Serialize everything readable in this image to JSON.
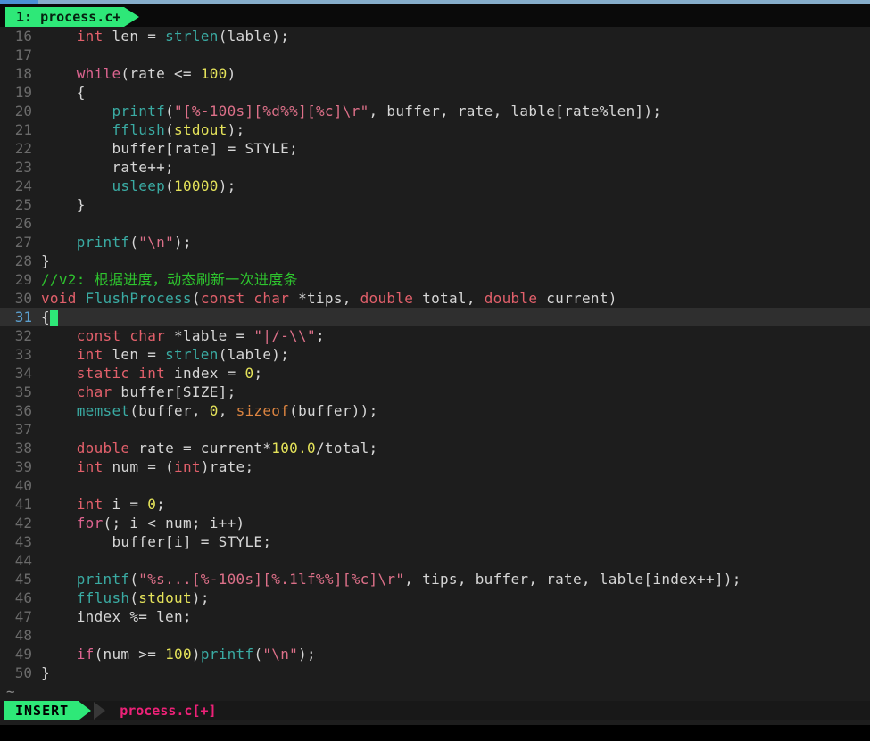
{
  "window": {
    "tab": {
      "label": "1: process.c+"
    },
    "status": {
      "mode": "INSERT",
      "file": "process.c[+]"
    },
    "empty_line_marker": "~"
  },
  "colors": {
    "ui": {
      "background": "#1d1d1d",
      "chrome_black": "#0a0a0a",
      "green": "#2ee878",
      "status_pink": "#ee2178",
      "topbar_active": "#4a90d6",
      "topbar_inactive": "#86aecb",
      "cursorline": "#2f2f2f",
      "gutter": "#6b6b6b",
      "gutter_active": "#5b9fce",
      "text": "#d6d6d6"
    },
    "syntax": {
      "kw": "#e2606b",
      "ctrl": "#dd6490",
      "str": "#dd7089",
      "fn": "#3aaba3",
      "num": "#e5e35a",
      "szof": "#dd8541",
      "com": "#2ec42e"
    }
  },
  "editor": {
    "cursor_line": 31,
    "lines": [
      {
        "n": 16,
        "t": [
          [
            "    "
          ],
          [
            "int",
            "kw"
          ],
          [
            " len = "
          ],
          [
            "strlen",
            "fn"
          ],
          [
            "(lable);"
          ]
        ]
      },
      {
        "n": 17,
        "t": []
      },
      {
        "n": 18,
        "t": [
          [
            "    "
          ],
          [
            "while",
            "ctrl"
          ],
          [
            "(rate <= "
          ],
          [
            "100",
            "num"
          ],
          [
            ")"
          ]
        ]
      },
      {
        "n": 19,
        "t": [
          [
            "    {"
          ]
        ]
      },
      {
        "n": 20,
        "t": [
          [
            "        "
          ],
          [
            "printf",
            "fn"
          ],
          [
            "("
          ],
          [
            "\"[%-100s][%d%%][%c]\\r\"",
            "str"
          ],
          [
            ", buffer, rate, lable[rate%len]);"
          ]
        ]
      },
      {
        "n": 21,
        "t": [
          [
            "        "
          ],
          [
            "fflush",
            "fn"
          ],
          [
            "("
          ],
          [
            "stdout",
            "num"
          ],
          [
            ");"
          ]
        ]
      },
      {
        "n": 22,
        "t": [
          [
            "        buffer[rate] = STYLE;"
          ]
        ]
      },
      {
        "n": 23,
        "t": [
          [
            "        rate++;"
          ]
        ]
      },
      {
        "n": 24,
        "t": [
          [
            "        "
          ],
          [
            "usleep",
            "fn"
          ],
          [
            "("
          ],
          [
            "10000",
            "num"
          ],
          [
            ");"
          ]
        ]
      },
      {
        "n": 25,
        "t": [
          [
            "    }"
          ]
        ]
      },
      {
        "n": 26,
        "t": []
      },
      {
        "n": 27,
        "t": [
          [
            "    "
          ],
          [
            "printf",
            "fn"
          ],
          [
            "("
          ],
          [
            "\"\\n\"",
            "str"
          ],
          [
            ");"
          ]
        ]
      },
      {
        "n": 28,
        "t": [
          [
            "}"
          ]
        ]
      },
      {
        "n": 29,
        "t": [
          [
            "//v2: 根据进度，动态刷新一次进度条",
            "com"
          ]
        ]
      },
      {
        "n": 30,
        "t": [
          [
            "void",
            "kw"
          ],
          [
            " "
          ],
          [
            "FlushProcess",
            "fn"
          ],
          [
            "("
          ],
          [
            "const",
            "kw"
          ],
          [
            " "
          ],
          [
            "char",
            "kw"
          ],
          [
            " *tips, "
          ],
          [
            "double",
            "kw"
          ],
          [
            " total, "
          ],
          [
            "double",
            "kw"
          ],
          [
            " current)"
          ]
        ]
      },
      {
        "n": 31,
        "cursor": true,
        "t": [
          [
            "{"
          ]
        ]
      },
      {
        "n": 32,
        "t": [
          [
            "    "
          ],
          [
            "const",
            "kw"
          ],
          [
            " "
          ],
          [
            "char",
            "kw"
          ],
          [
            " *lable = "
          ],
          [
            "\"|/-\\\\\"",
            "str"
          ],
          [
            ";"
          ]
        ]
      },
      {
        "n": 33,
        "t": [
          [
            "    "
          ],
          [
            "int",
            "kw"
          ],
          [
            " len = "
          ],
          [
            "strlen",
            "fn"
          ],
          [
            "(lable);"
          ]
        ]
      },
      {
        "n": 34,
        "t": [
          [
            "    "
          ],
          [
            "static",
            "kw"
          ],
          [
            " "
          ],
          [
            "int",
            "kw"
          ],
          [
            " index = "
          ],
          [
            "0",
            "num"
          ],
          [
            ";"
          ]
        ]
      },
      {
        "n": 35,
        "t": [
          [
            "    "
          ],
          [
            "char",
            "kw"
          ],
          [
            " buffer[SIZE];"
          ]
        ]
      },
      {
        "n": 36,
        "t": [
          [
            "    "
          ],
          [
            "memset",
            "fn"
          ],
          [
            "(buffer, "
          ],
          [
            "0",
            "num"
          ],
          [
            ", "
          ],
          [
            "sizeof",
            "szof"
          ],
          [
            "(buffer));"
          ]
        ]
      },
      {
        "n": 37,
        "t": []
      },
      {
        "n": 38,
        "t": [
          [
            "    "
          ],
          [
            "double",
            "kw"
          ],
          [
            " rate = current*"
          ],
          [
            "100.0",
            "num"
          ],
          [
            "/total;"
          ]
        ]
      },
      {
        "n": 39,
        "t": [
          [
            "    "
          ],
          [
            "int",
            "kw"
          ],
          [
            " num = ("
          ],
          [
            "int",
            "kw"
          ],
          [
            ")rate;"
          ]
        ]
      },
      {
        "n": 40,
        "t": []
      },
      {
        "n": 41,
        "t": [
          [
            "    "
          ],
          [
            "int",
            "kw"
          ],
          [
            " i = "
          ],
          [
            "0",
            "num"
          ],
          [
            ";"
          ]
        ]
      },
      {
        "n": 42,
        "t": [
          [
            "    "
          ],
          [
            "for",
            "ctrl"
          ],
          [
            "(; i < num; i++)"
          ]
        ]
      },
      {
        "n": 43,
        "t": [
          [
            "        buffer[i] = STYLE;"
          ]
        ]
      },
      {
        "n": 44,
        "t": []
      },
      {
        "n": 45,
        "t": [
          [
            "    "
          ],
          [
            "printf",
            "fn"
          ],
          [
            "("
          ],
          [
            "\"%s...[%-100s][%.1lf%%][%c]\\r\"",
            "str"
          ],
          [
            ", tips, buffer, rate, lable[index++]);"
          ]
        ]
      },
      {
        "n": 46,
        "t": [
          [
            "    "
          ],
          [
            "fflush",
            "fn"
          ],
          [
            "("
          ],
          [
            "stdout",
            "num"
          ],
          [
            ");"
          ]
        ]
      },
      {
        "n": 47,
        "t": [
          [
            "    index %= len;"
          ]
        ]
      },
      {
        "n": 48,
        "t": []
      },
      {
        "n": 49,
        "t": [
          [
            "    "
          ],
          [
            "if",
            "ctrl"
          ],
          [
            "(num >= "
          ],
          [
            "100",
            "num"
          ],
          [
            ")"
          ],
          [
            "printf",
            "fn"
          ],
          [
            "("
          ],
          [
            "\"\\n\"",
            "str"
          ],
          [
            ");"
          ]
        ]
      },
      {
        "n": 50,
        "t": [
          [
            "}"
          ]
        ]
      }
    ]
  }
}
